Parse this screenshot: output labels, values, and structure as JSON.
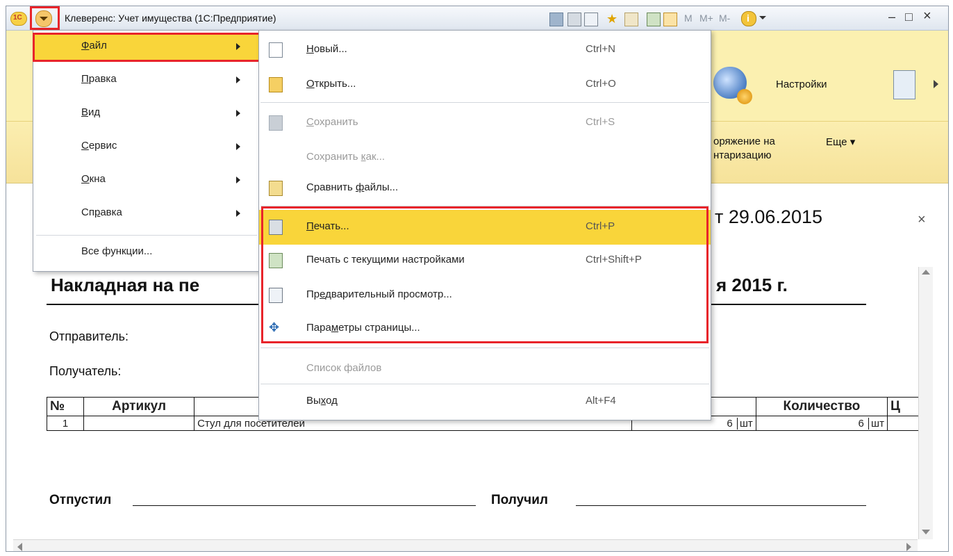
{
  "titlebar": {
    "title": "Клеверенс: Учет имущества  (1С:Предприятие)",
    "right_buttons": [
      "M",
      "M+",
      "M-",
      "–",
      "□",
      "×"
    ]
  },
  "section_panel": {
    "settings_label": "Настройки"
  },
  "command_bar": {
    "order_label_line1": "оряжение на",
    "order_label_line2": "нтаризацию",
    "more_label": "Еще ▾"
  },
  "document": {
    "date_fragment": "т 29.06.2015",
    "title_left": "Накладная на пе",
    "title_right": "я 2015 г.",
    "sender_label": "Отправитель:",
    "recipient_label": "Получатель:",
    "table": {
      "headers": [
        "№",
        "Артикул",
        "",
        "",
        "Количество",
        "Ц"
      ],
      "rows": [
        {
          "num": "1",
          "article": "",
          "name": "Стул для посетителей",
          "qty1": "6",
          "unit1": "шт",
          "qty2": "6",
          "unit2": "шт"
        }
      ]
    },
    "released_label": "Отпустил",
    "received_label": "Получил",
    "close_glyph": "×"
  },
  "main_menu": {
    "items": [
      {
        "label": "Файл",
        "u": "Ф",
        "rest": "айл",
        "has_submenu": true
      },
      {
        "label": "Правка",
        "u": "П",
        "rest": "равка",
        "has_submenu": true
      },
      {
        "label": "Вид",
        "u": "В",
        "rest": "ид",
        "has_submenu": true
      },
      {
        "label": "Сервис",
        "u": "С",
        "rest": "ервис",
        "has_submenu": true
      },
      {
        "label": "Окна",
        "u": "О",
        "rest": "кна",
        "has_submenu": true
      },
      {
        "label": "Справка",
        "pre": "Сп",
        "u": "р",
        "rest": "авка",
        "has_submenu": true
      },
      {
        "label": "Все функции...",
        "has_submenu": false
      }
    ]
  },
  "file_menu": {
    "items": [
      {
        "pre": "",
        "u": "Н",
        "rest": "овый...",
        "shortcut": "Ctrl+N"
      },
      {
        "pre": "",
        "u": "О",
        "rest": "ткрыть...",
        "shortcut": "Ctrl+O"
      },
      {
        "pre": "",
        "u": "С",
        "rest": "охранить",
        "shortcut": "Ctrl+S"
      },
      {
        "pre": "Сохранить ",
        "u": "к",
        "rest": "ак...",
        "shortcut": ""
      },
      {
        "pre": "Сравнить ",
        "u": "ф",
        "rest": "айлы...",
        "shortcut": ""
      },
      {
        "pre": "",
        "u": "П",
        "rest": "ечать...",
        "shortcut": "Ctrl+P"
      },
      {
        "pre": "Печать с текущими настройками",
        "u": "",
        "rest": "",
        "shortcut": "Ctrl+Shift+P"
      },
      {
        "pre": "Пр",
        "u": "е",
        "rest": "дварительный просмотр...",
        "shortcut": ""
      },
      {
        "pre": "Пара",
        "u": "м",
        "rest": "етры страницы...",
        "shortcut": ""
      },
      {
        "pre": "Список файлов",
        "u": "",
        "rest": "",
        "shortcut": ""
      },
      {
        "pre": "Вы",
        "u": "х",
        "rest": "од",
        "shortcut": "Alt+F4"
      }
    ]
  },
  "colors": {
    "highlight": "#f9d53a",
    "frame": "#e8242a",
    "panel": "#fbf0b0"
  }
}
